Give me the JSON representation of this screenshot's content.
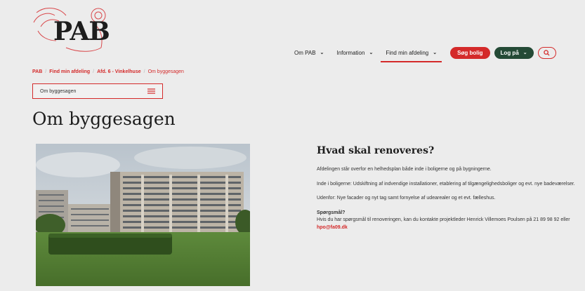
{
  "logo": {
    "text": "PAB"
  },
  "nav": {
    "items": [
      {
        "label": "Om PAB"
      },
      {
        "label": "Information"
      },
      {
        "label": "Find min afdeling"
      }
    ],
    "search_home_label": "Søg bolig",
    "login_label": "Log på"
  },
  "breadcrumb": {
    "items": [
      "PAB",
      "Find min afdeling",
      "Afd. 6 - Vinkelhuse",
      "Om byggesagen"
    ]
  },
  "dropdown": {
    "label": "Om byggesagen"
  },
  "page": {
    "title": "Om byggesagen"
  },
  "content": {
    "heading": "Hvad skal renoveres?",
    "p1": "Afdelingen står overfor en helhedsplan både inde i boligerne og på bygningerne.",
    "p2": "Inde i boligerne: Udskiftning af indvendige installationer, etablering af tilgængelighedsboliger og evt. nye badeværelser.",
    "p3": "Udenfor: Nye facader og nyt tag samt fornyelse af udearealer og et evt. fælleshus.",
    "q_title": "Spørgsmål?",
    "q_text": "Hvis du har spørgsmål til renoveringen, kan du kontakte projektleder Henrick Villemoes Poulsen på 21 89 98 92 eller",
    "q_email": "hpo@fa09.dk"
  },
  "colors": {
    "accent": "#d42a2a",
    "login": "#244a36",
    "background": "#ececec"
  }
}
